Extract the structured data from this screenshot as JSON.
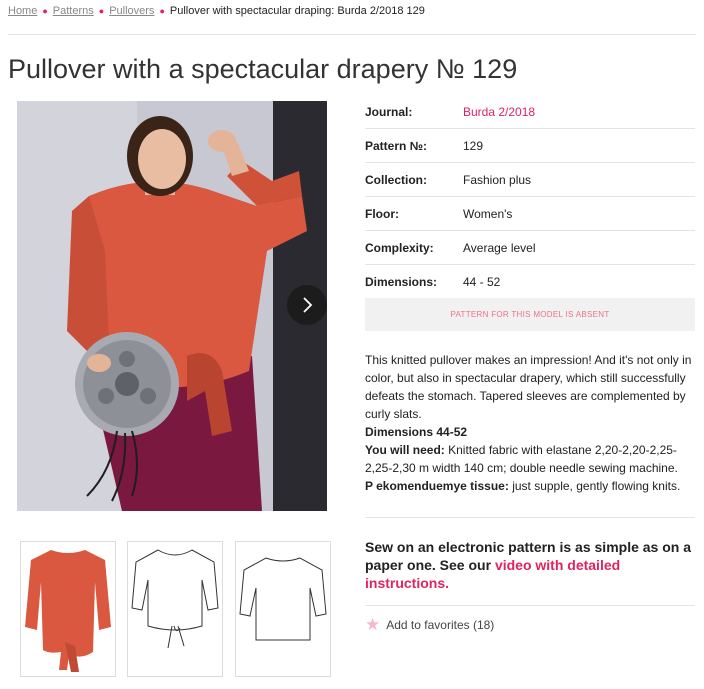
{
  "breadcrumb": {
    "items": [
      "Home",
      "Patterns",
      "Pullovers"
    ],
    "current": "Pullover with spectacular draping: Burda 2/2018 129"
  },
  "page": {
    "title": "Pullover with a spectacular drapery № 129"
  },
  "specs": [
    {
      "label": "Journal:",
      "value": "Burda 2/2018"
    },
    {
      "label": "Pattern №:",
      "value": "129"
    },
    {
      "label": "Collection:",
      "value": "Fashion plus"
    },
    {
      "label": "Floor:",
      "value": "Women's"
    },
    {
      "label": "Complexity:",
      "value": "Average level"
    },
    {
      "label": "Dimensions:",
      "value": "44 - 52"
    }
  ],
  "absent_notice": "PATTERN FOR THIS MODEL IS ABSENT",
  "description": {
    "intro": "This knitted pullover makes an impression! And it's not only in color, but also in spectacular drapery, which still successfully defeats the stomach. Tapered sleeves are complemented by curly slats.",
    "dimensions": "Dimensions 44-52",
    "need_label": "You will need:",
    "need_text": "Knitted fabric with elastane 2,20-2,20-2,25-2,25-2,30 m width 140 cm; double needle sewing machine.",
    "tissue_label": "P ekomenduemye tissue:",
    "tissue_text": "just supple, gently flowing knits."
  },
  "promo": {
    "text": "Sew on an electronic pattern is as simple as on a paper one. See our",
    "link": "video with detailed instructions."
  },
  "favorites": {
    "label": "Add to favorites (18)"
  },
  "icons": {
    "next": "chevron-right-icon",
    "favorite": "star-icon"
  },
  "colors": {
    "accent": "#e0245e",
    "garment": "#d9583f",
    "skirt": "#7a1840"
  }
}
